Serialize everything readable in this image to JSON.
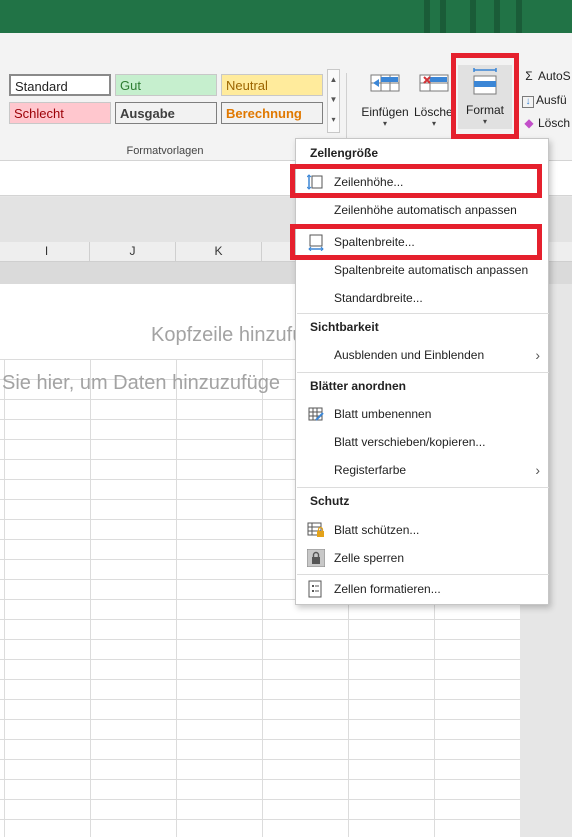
{
  "styles": {
    "group_label": "Formatvorlagen",
    "cells": [
      {
        "label": "Standard",
        "bg": "#ffffff",
        "color": "#222222",
        "bold": false
      },
      {
        "label": "Gut",
        "bg": "#c6efce",
        "color": "#2e7d32",
        "bold": false
      },
      {
        "label": "Neutral",
        "bg": "#ffeb9c",
        "color": "#9c6500",
        "bold": false
      },
      {
        "label": "Schlecht",
        "bg": "#ffc7ce",
        "color": "#9c0006",
        "bold": false
      },
      {
        "label": "Ausgabe",
        "bg": "#f2f2f2",
        "color": "#3f3f3f",
        "bold": true
      },
      {
        "label": "Berechnung",
        "bg": "#f2f2f2",
        "color": "#e07800",
        "bold": true
      }
    ]
  },
  "ribbon": {
    "insert_label": "Einfügen",
    "delete_label": "Lösche",
    "format_label": "Format",
    "autosum_label": "AutoS",
    "fill_label": "Ausfü",
    "clear_label": "Lösch"
  },
  "columns": [
    "I",
    "J",
    "K"
  ],
  "sheet": {
    "header_hint": "Kopfzeile hinzufü",
    "data_hint": "Sie hier, um Daten hinzuzufüge"
  },
  "menu": {
    "sections": {
      "cell_size": "Zellengröße",
      "visibility": "Sichtbarkeit",
      "arrange_sheets": "Blätter anordnen",
      "protection": "Schutz"
    },
    "items": {
      "row_height": "Zeilenhöhe...",
      "autofit_row": "Zeilenhöhe automatisch anpassen",
      "column_width": "Spaltenbreite...",
      "autofit_column": "Spaltenbreite automatisch anpassen",
      "default_width": "Standardbreite...",
      "hide_unhide": "Ausblenden und Einblenden",
      "rename_sheet": "Blatt umbenennen",
      "move_copy_sheet": "Blatt verschieben/kopieren...",
      "tab_color": "Registerfarbe",
      "protect_sheet": "Blatt schützen...",
      "lock_cell": "Zelle sperren",
      "format_cells": "Zellen formatieren..."
    }
  },
  "colors": {
    "highlight": "#e5202d",
    "titlebar": "#217346"
  }
}
